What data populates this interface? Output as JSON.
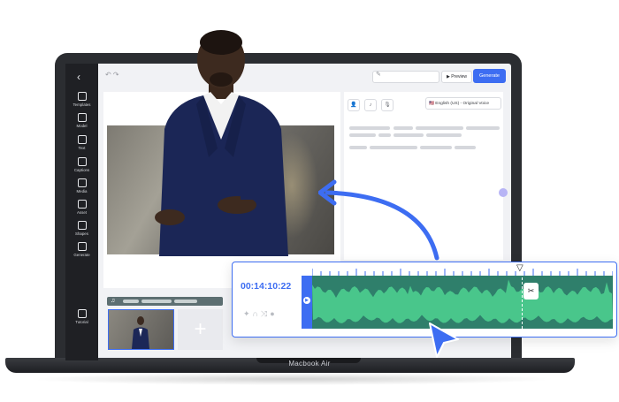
{
  "app": {
    "sidebar": {
      "items": [
        {
          "label": "Templates",
          "icon": "templates-icon"
        },
        {
          "label": "Model",
          "icon": "model-icon"
        },
        {
          "label": "Text",
          "icon": "text-icon"
        },
        {
          "label": "Captions",
          "icon": "captions-icon"
        },
        {
          "label": "Media",
          "icon": "media-icon"
        },
        {
          "label": "Asset",
          "icon": "asset-icon"
        },
        {
          "label": "Shapes",
          "icon": "shapes-icon"
        },
        {
          "label": "Generate",
          "icon": "generate-icon"
        }
      ],
      "tutorial": {
        "label": "Tutorial",
        "icon": "tutorial-icon"
      }
    },
    "toolbar": {
      "undo_redo": "↶ ↷",
      "preview_label": "▶ Preview",
      "generate_label": "Generate"
    },
    "script_panel": {
      "voice": "🇺🇸 English (US) - Original Voice"
    },
    "scenes": {
      "add_label": "+"
    },
    "timeline": {
      "timecode": "00:14:10:22"
    }
  },
  "laptop": {
    "model_label": "Macbook Air"
  },
  "colors": {
    "accent": "#3d6df2",
    "waveform": "#49c68b",
    "waveform_bg": "#2f7f6b",
    "sidebar": "#1f2024"
  }
}
